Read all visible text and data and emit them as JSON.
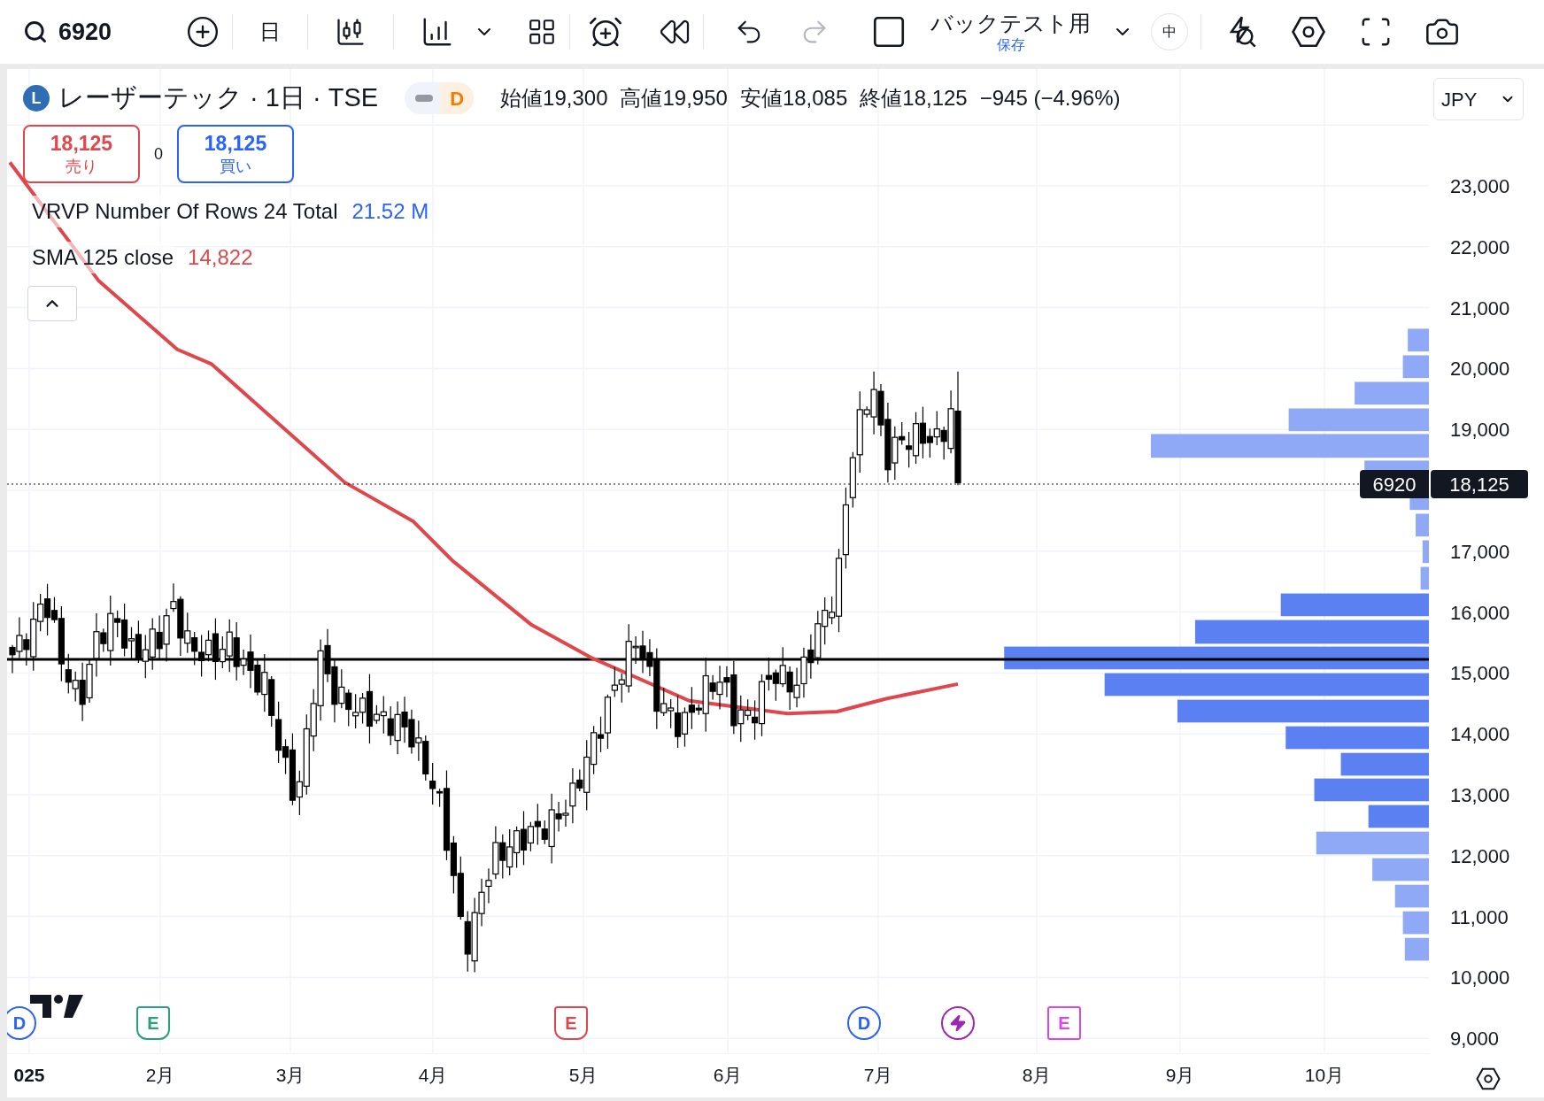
{
  "toolbar": {
    "symbol": "6920",
    "interval": "日",
    "layout_name": "バックテスト用",
    "layout_status": "保存",
    "size_badge": "中"
  },
  "legend": {
    "logo_letter": "L",
    "title": "レーザーテック · 1日 · TSE",
    "badge_letter": "D",
    "ohlc": [
      {
        "label": "始値",
        "value": "19,300"
      },
      {
        "label": "高値",
        "value": "19,950"
      },
      {
        "label": "安値",
        "value": "18,085"
      },
      {
        "label": "終値",
        "value": "18,125"
      }
    ],
    "change": "−945 (−4.96%)"
  },
  "currency": "JPY",
  "trade": {
    "sell": {
      "price": "18,125",
      "label": "売り"
    },
    "spread": "0",
    "buy": {
      "price": "18,125",
      "label": "買い"
    }
  },
  "indicators": [
    {
      "text": "VRVP Number Of Rows 24 Total",
      "value": "21.52 M",
      "color": "#2962ff"
    },
    {
      "text": "SMA 125 close",
      "value": "14,822",
      "color": "#e0474c"
    }
  ],
  "price_axis": [
    "23,000",
    "22,000",
    "21,000",
    "20,000",
    "19,000",
    "17,000",
    "16,000",
    "15,000",
    "14,000",
    "13,000",
    "12,000",
    "11,000",
    "10,000",
    "9,000"
  ],
  "last_price": {
    "symbol_label": "6920",
    "value": "18,125"
  },
  "time_axis": [
    "025",
    "2月",
    "3月",
    "4月",
    "5月",
    "6月",
    "7月",
    "8月",
    "9月",
    "10月"
  ],
  "events": [
    {
      "kind": "dividend",
      "letter": "D",
      "color": "#2962ff"
    },
    {
      "kind": "earnings",
      "letter": "E",
      "color": "#26a17b"
    },
    {
      "kind": "earnings",
      "letter": "E",
      "color": "#e0474c"
    },
    {
      "kind": "dividend",
      "letter": "D",
      "color": "#2962ff"
    },
    {
      "kind": "split",
      "color": "#9c27b0"
    },
    {
      "kind": "future",
      "letter": "E",
      "color": "#d946ef"
    }
  ]
}
